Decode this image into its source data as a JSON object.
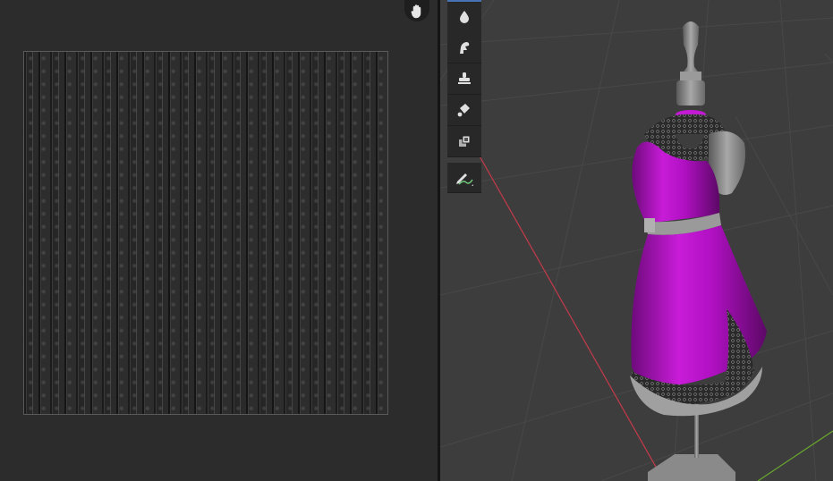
{
  "image_editor": {
    "pan_tool": {
      "icon": "hand-icon"
    },
    "texture": {
      "description_icon": "texture-image"
    }
  },
  "viewport": {
    "tools": [
      {
        "name": "draw",
        "icon": "brush-drop-icon"
      },
      {
        "name": "smear",
        "icon": "smear-icon"
      },
      {
        "name": "clone",
        "icon": "stamp-icon"
      },
      {
        "name": "fill",
        "icon": "paint-bucket-icon"
      },
      {
        "name": "mask",
        "icon": "mask-icon"
      },
      {
        "name": "annotate",
        "icon": "annotate-pencil-icon"
      }
    ],
    "colors": {
      "background": "#3d3d3d",
      "grid": "#4a4a4a",
      "x_axis": "#c53a4a",
      "y_axis": "#6aa82f",
      "dress": "#b20fc4",
      "mannequin": "#8e8e8e"
    }
  }
}
